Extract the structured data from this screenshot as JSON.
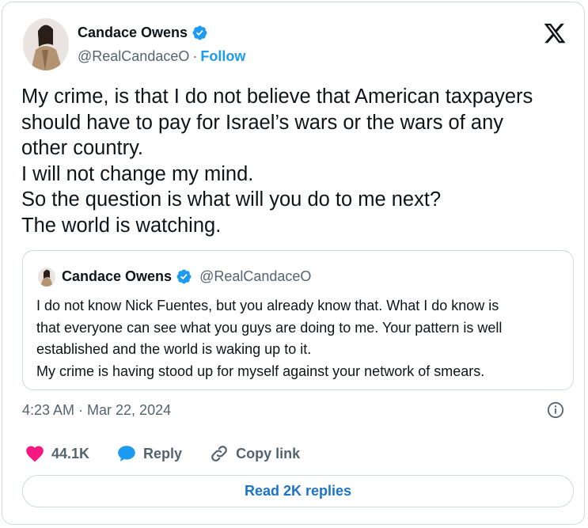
{
  "author": {
    "name": "Candace Owens",
    "handle": "@RealCandaceO",
    "separator": "·",
    "follow_label": "Follow"
  },
  "tweet": {
    "lines": [
      "My crime, is that I do not believe that American taxpayers",
      "should have to pay for Israel’s wars or the wars of any",
      "other country.",
      "I will not change my mind.",
      "So the question is what will you do to me next?",
      "The world is watching."
    ]
  },
  "quote": {
    "name": "Candace Owens",
    "handle": "@RealCandaceO",
    "lines": [
      "I do not know Nick Fuentes, but you already know that. What I do know is",
      "that everyone can see what you guys are doing to me. Your pattern is well",
      "established and the world is waking up to it.",
      "My crime is having stood up for myself against your network of smears."
    ]
  },
  "timestamp": "4:23 AM · Mar 22, 2024",
  "actions": {
    "likes": "44.1K",
    "reply_label": "Reply",
    "copy_link_label": "Copy link"
  },
  "replies_button": "Read 2K replies",
  "colors": {
    "accent": "#1d9bf0",
    "heart": "#f91880",
    "muted": "#536471",
    "border": "#cfd9de"
  },
  "icons": [
    "verified-badge-icon",
    "x-logo-icon",
    "info-icon",
    "heart-icon",
    "reply-bubble-icon",
    "link-icon"
  ]
}
